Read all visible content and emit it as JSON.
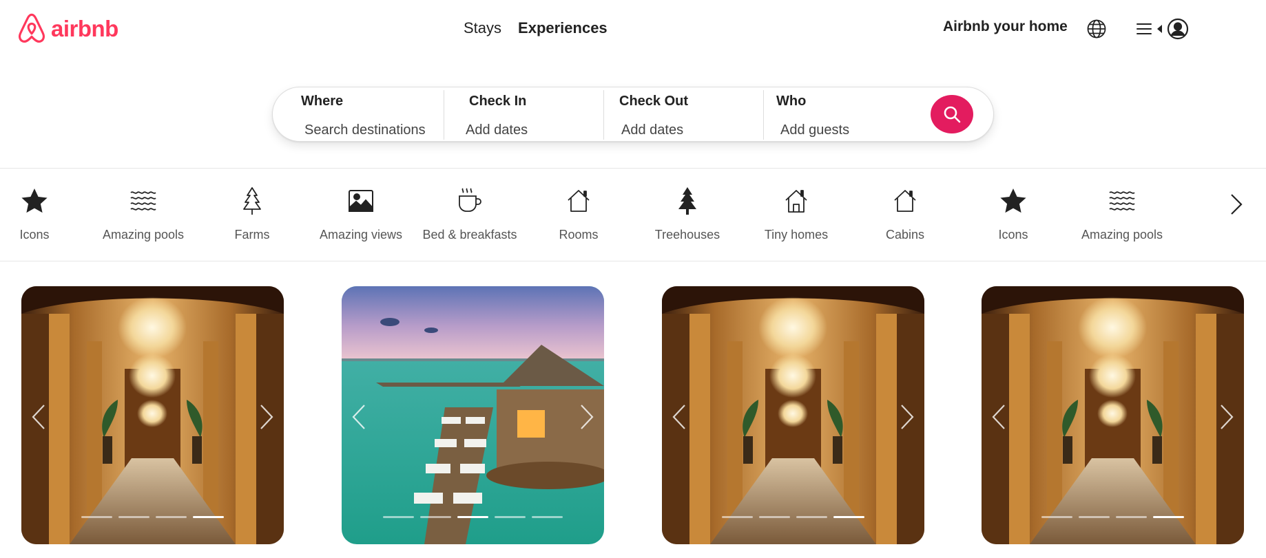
{
  "header": {
    "logo_text": "airbnb",
    "nav": [
      {
        "label": "Stays",
        "active": false
      },
      {
        "label": "Experiences",
        "active": true
      }
    ],
    "host_link": "Airbnb your home",
    "icons": [
      "globe-icon",
      "hamburger-menu-icon",
      "caret-left-icon",
      "user-avatar-icon"
    ]
  },
  "search": {
    "where": {
      "label": "Where",
      "value": "Search destinations"
    },
    "check_in": {
      "label": "Check In",
      "value": "Add dates"
    },
    "check_out": {
      "label": "Check Out",
      "value": "Add dates"
    },
    "who": {
      "label": "Who",
      "value": "Add guests"
    },
    "button_icon": "search-icon"
  },
  "categories": [
    {
      "label": "Icons",
      "icon": "star-icon"
    },
    {
      "label": "Amazing pools",
      "icon": "waves-icon"
    },
    {
      "label": "Farms",
      "icon": "pine-tree-outline-icon"
    },
    {
      "label": "Amazing views",
      "icon": "picture-icon"
    },
    {
      "label": "Bed & breakfasts",
      "icon": "coffee-cup-icon"
    },
    {
      "label": "Rooms",
      "icon": "house-icon"
    },
    {
      "label": "Treehouses",
      "icon": "pine-tree-filled-icon"
    },
    {
      "label": "Tiny homes",
      "icon": "tiny-home-icon"
    },
    {
      "label": "Cabins",
      "icon": "cabin-icon"
    },
    {
      "label": "Icons",
      "icon": "star-icon"
    },
    {
      "label": "Amazing pools",
      "icon": "waves-icon"
    }
  ],
  "listings": [
    {
      "photo": "palace-hallway-chandeliers",
      "dots": 4,
      "active_dot": 3
    },
    {
      "photo": "overwater-bungalow-deck",
      "dots": 5,
      "active_dot": 2
    },
    {
      "photo": "palace-hallway-chandeliers",
      "dots": 4,
      "active_dot": 3
    },
    {
      "photo": "palace-hallway-chandeliers",
      "dots": 4,
      "active_dot": 3
    }
  ],
  "colors": {
    "brand": "#FF385C",
    "search_button": "#E31C5F",
    "text": "#222222",
    "muted_text": "#555555"
  }
}
